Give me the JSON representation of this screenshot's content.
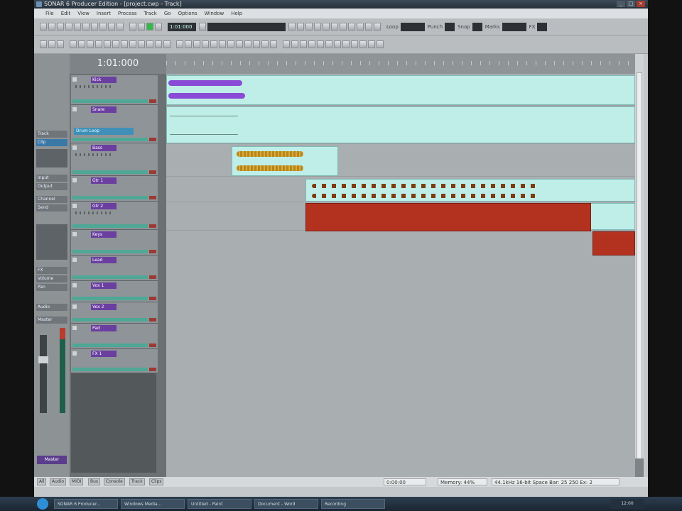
{
  "window": {
    "title": "SONAR 6 Producer Edition - [project.cwp - Track]",
    "controls": [
      "_",
      "□",
      "×"
    ]
  },
  "menu": [
    "File",
    "Edit",
    "View",
    "Insert",
    "Process",
    "Track",
    "Go",
    "Options",
    "Window",
    "Help"
  ],
  "toolbar1": {
    "lcd1": "1:01:000",
    "lcd2": "",
    "labels": [
      "Loop",
      "Punch",
      "Snap",
      "Marks",
      "FX"
    ]
  },
  "timecode": "1:01:000",
  "left_panel": {
    "items": [
      "Track Inspector",
      "Clip",
      "Input",
      "Output",
      "Channel",
      "Send",
      "FX",
      "Volume",
      "Pan",
      "Audio",
      "Master"
    ],
    "selected_strip": "Master"
  },
  "tracks": [
    {
      "name": "Kick",
      "label": ""
    },
    {
      "name": "Snare",
      "label": "Drum Loop"
    },
    {
      "name": "Bass",
      "label": ""
    },
    {
      "name": "Gtr 1",
      "label": ""
    },
    {
      "name": "Gtr 2",
      "label": ""
    },
    {
      "name": "Keys",
      "label": ""
    },
    {
      "name": "Lead",
      "label": ""
    },
    {
      "name": "Vox 1",
      "label": ""
    },
    {
      "name": "Vox 2",
      "label": ""
    },
    {
      "name": "Pad",
      "label": ""
    },
    {
      "name": "FX 1",
      "label": ""
    }
  ],
  "status_bar": {
    "tabs": [
      "All",
      "Audio",
      "MIDI",
      "Bus",
      "Console",
      "Track",
      "Clips"
    ],
    "position": "0:00:00",
    "memory": "Memory: 44%",
    "info": "44.1kHz 16-bit  Space Bar: 25  250 Ex: 2"
  },
  "taskbar": {
    "items": [
      "SONAR 6 Producer...",
      "Windows Media...",
      "Untitled - Paint",
      "Document - Word",
      "Recording"
    ],
    "tray_time": "12:00"
  },
  "colors": {
    "accent_purple": "#6a3fa0",
    "clip_teal": "#bfeee8",
    "clip_red": "#b3321f",
    "waveform_gold": "#c99a2c"
  }
}
